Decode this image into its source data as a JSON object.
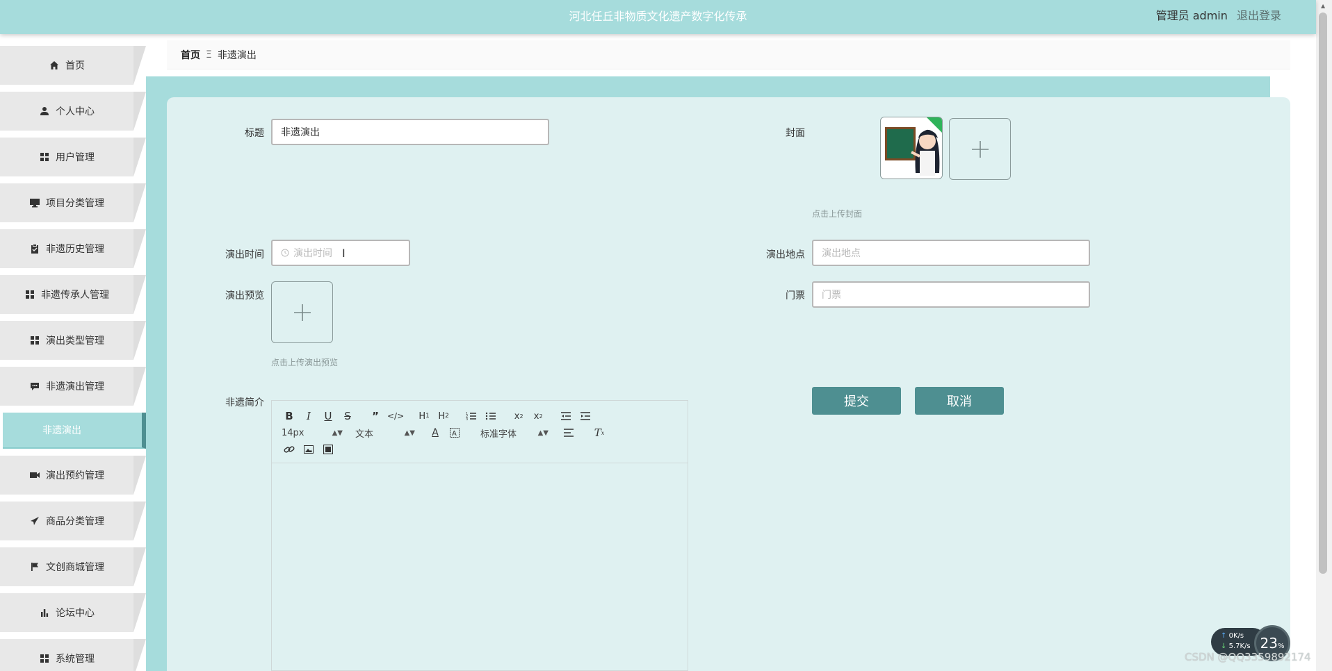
{
  "header": {
    "site_title": "河北任丘非物质文化遗产数字化传承",
    "user_label": "管理员 admin",
    "logout_label": "退出登录"
  },
  "sidebar": {
    "items": [
      {
        "label": "首页",
        "icon": "home-icon"
      },
      {
        "label": "个人中心",
        "icon": "user-icon"
      },
      {
        "label": "用户管理",
        "icon": "grid-icon"
      },
      {
        "label": "项目分类管理",
        "icon": "monitor-icon"
      },
      {
        "label": "非遗历史管理",
        "icon": "clipboard-icon"
      },
      {
        "label": "非遗传承人管理",
        "icon": "grid-icon"
      },
      {
        "label": "演出类型管理",
        "icon": "grid-icon"
      },
      {
        "label": "非遗演出管理",
        "icon": "comment-icon"
      }
    ],
    "active_sub": "非遗演出",
    "items_after": [
      {
        "label": "演出预约管理",
        "icon": "video-icon"
      },
      {
        "label": "商品分类管理",
        "icon": "send-icon"
      },
      {
        "label": "文创商城管理",
        "icon": "flag-icon"
      },
      {
        "label": "论坛中心",
        "icon": "bar-chart-icon"
      },
      {
        "label": "系统管理",
        "icon": "grid-icon"
      }
    ]
  },
  "breadcrumb": {
    "home": "首页",
    "separator": "Ξ",
    "current": "非遗演出"
  },
  "form": {
    "title_label": "标题",
    "title_value": "非遗演出",
    "cover_label": "封面",
    "cover_hint": "点击上传封面",
    "time_label": "演出时间",
    "time_placeholder": "演出时间",
    "location_label": "演出地点",
    "location_placeholder": "演出地点",
    "preview_label": "演出预览",
    "preview_hint": "点击上传演出预览",
    "ticket_label": "门票",
    "ticket_placeholder": "门票",
    "intro_label": "非遗简介",
    "submit_label": "提交",
    "cancel_label": "取消"
  },
  "editor": {
    "font_size": "14px",
    "paragraph": "文本",
    "font_family": "标准字体"
  },
  "widget": {
    "up_speed": "0K/s",
    "down_speed": "5.7K/s",
    "percent": "23",
    "percent_unit": "%"
  },
  "watermark": "CSDN @QQ3359892174",
  "colors": {
    "header_bg": "#a6dcdc",
    "accent": "#4e8f91",
    "card_bg": "#dff1f1"
  }
}
